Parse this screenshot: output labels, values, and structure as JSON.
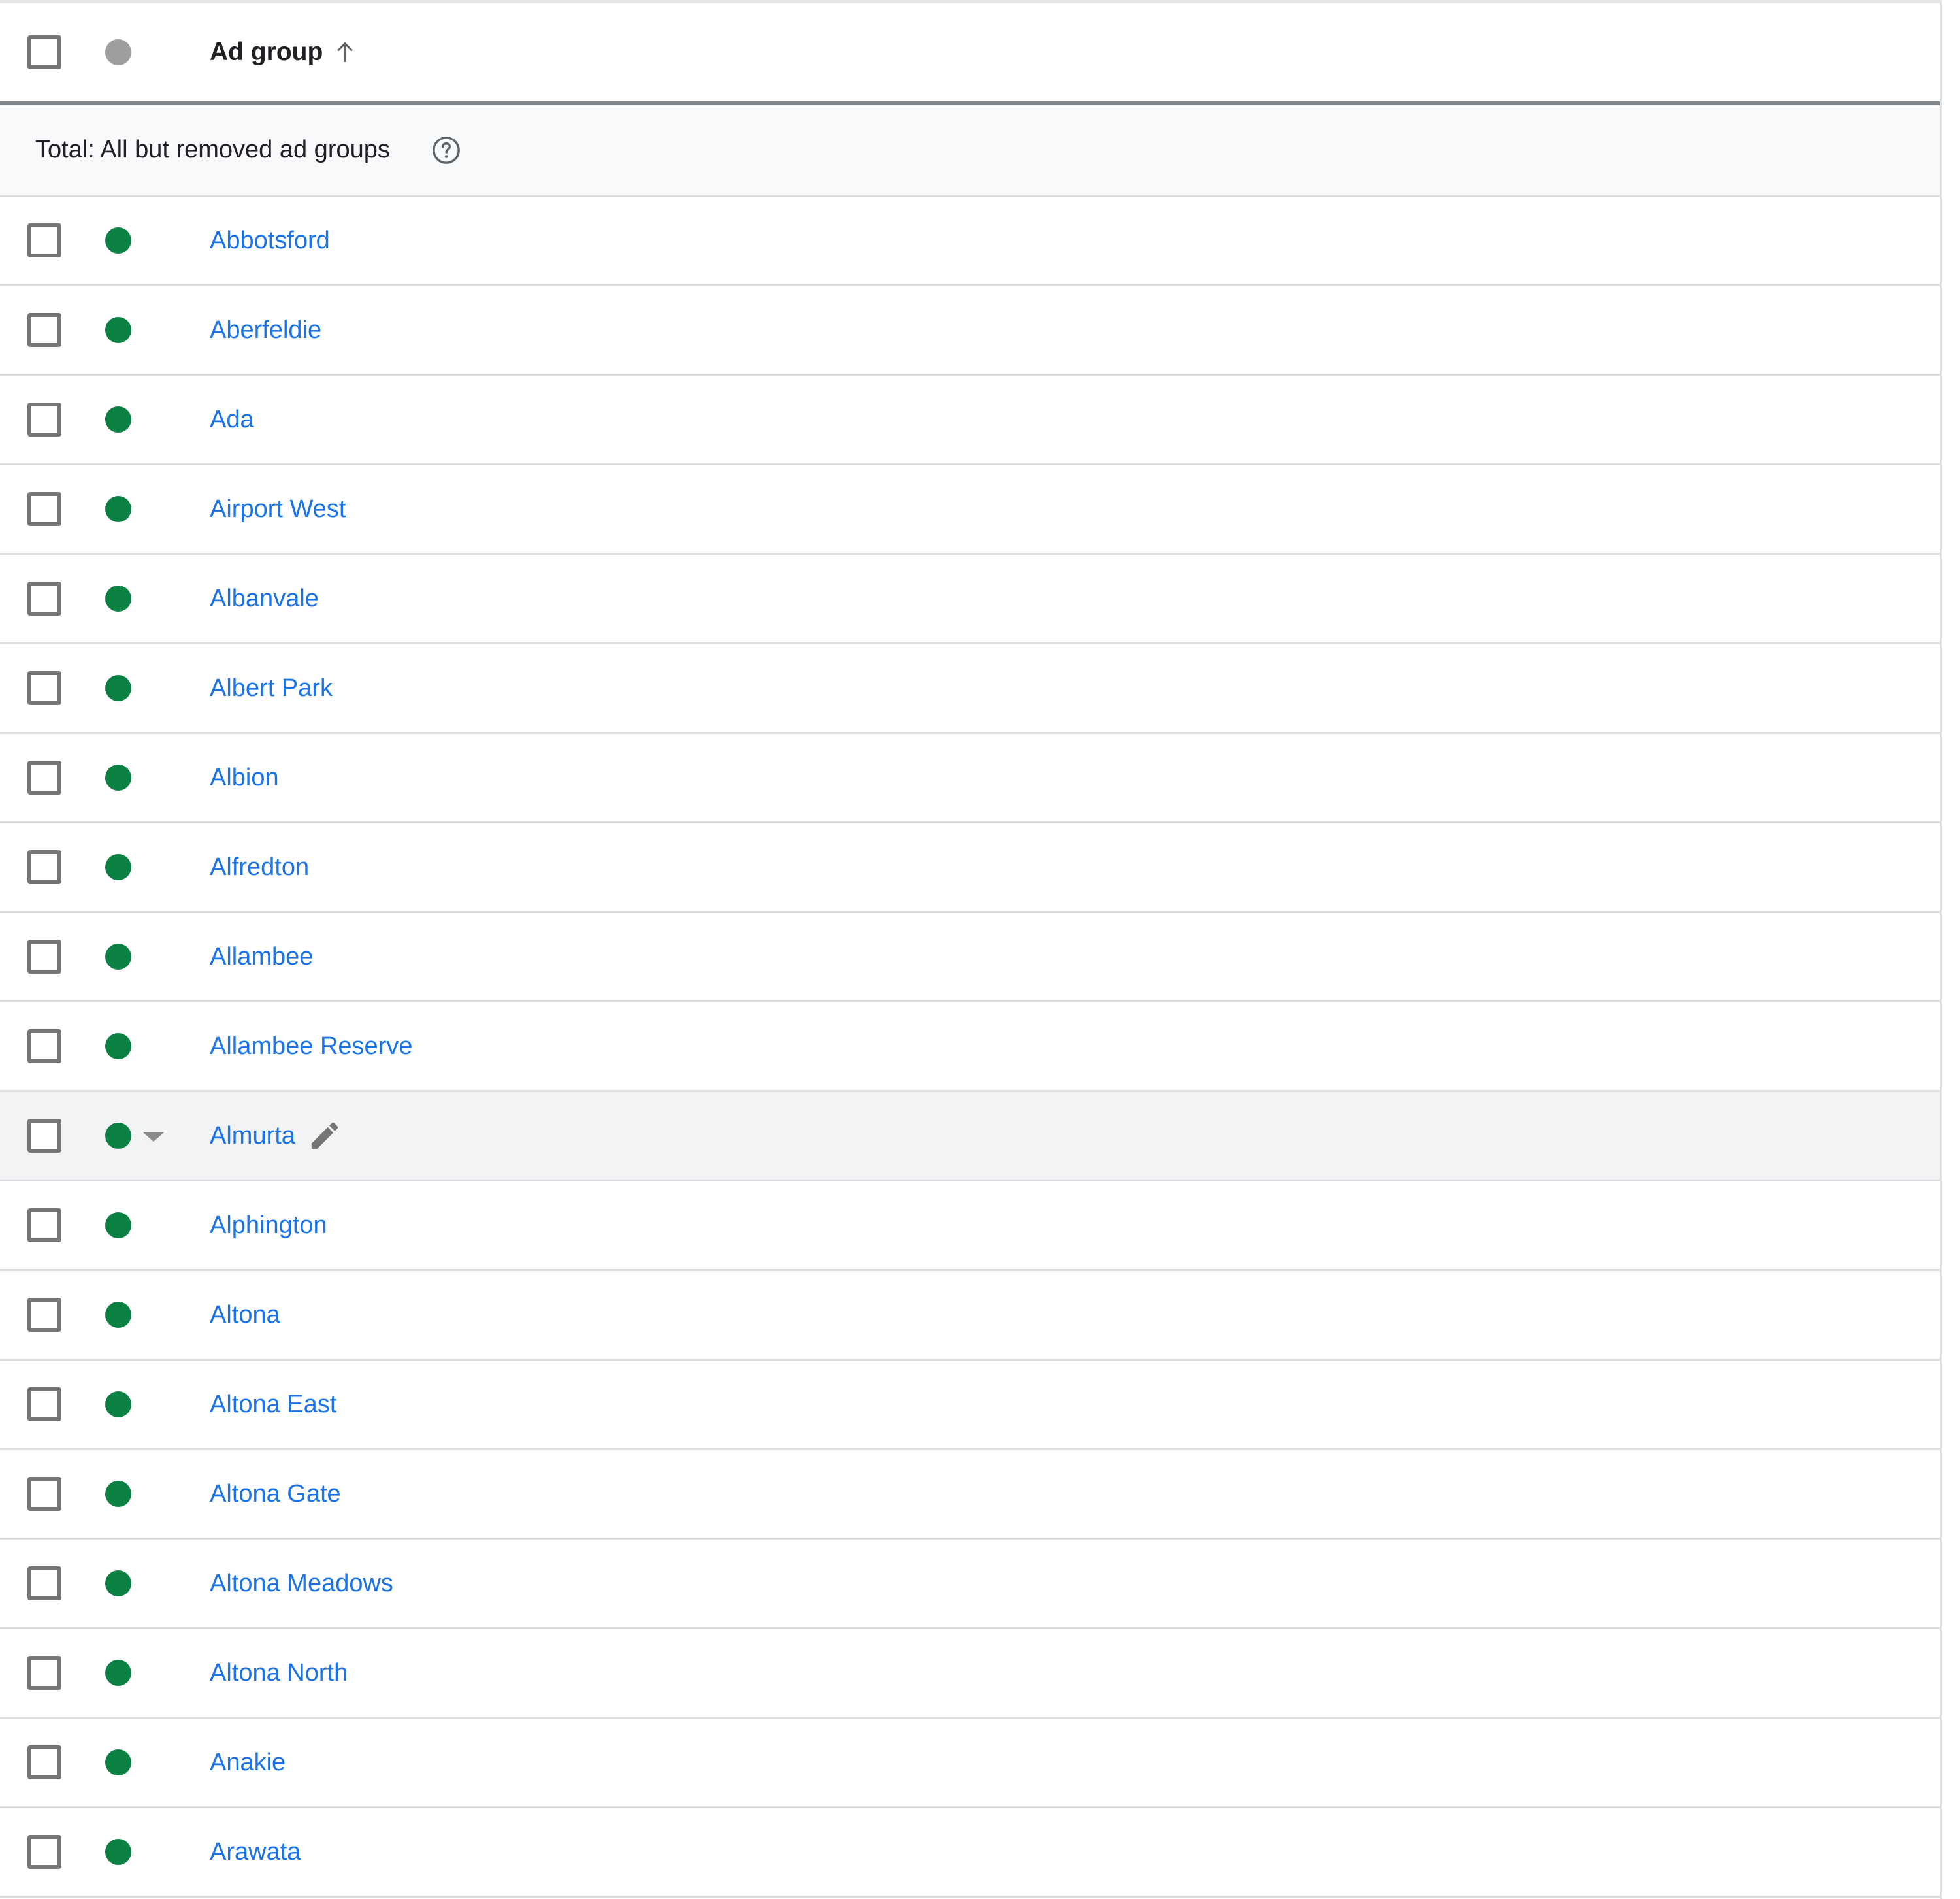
{
  "table": {
    "header": {
      "column_label": "Ad group",
      "sort_direction": "ascending",
      "sort_icon": "arrow-up-icon",
      "status_icon": "status-dot-icon"
    },
    "total_row": {
      "label": "Total: All but removed ad groups",
      "help_icon": "help-circle-icon"
    },
    "status_colors": {
      "enabled": "#0b8043",
      "header": "#9e9e9e"
    },
    "link_color": "#1a73e8",
    "rows": [
      {
        "name": "Abbotsford",
        "status": "enabled",
        "checked": false
      },
      {
        "name": "Aberfeldie",
        "status": "enabled",
        "checked": false
      },
      {
        "name": "Ada",
        "status": "enabled",
        "checked": false
      },
      {
        "name": "Airport West",
        "status": "enabled",
        "checked": false
      },
      {
        "name": "Albanvale",
        "status": "enabled",
        "checked": false
      },
      {
        "name": "Albert Park",
        "status": "enabled",
        "checked": false
      },
      {
        "name": "Albion",
        "status": "enabled",
        "checked": false
      },
      {
        "name": "Alfredton",
        "status": "enabled",
        "checked": false
      },
      {
        "name": "Allambee",
        "status": "enabled",
        "checked": false
      },
      {
        "name": "Allambee Reserve",
        "status": "enabled",
        "checked": false
      },
      {
        "name": "Almurta",
        "status": "enabled",
        "checked": false,
        "hovered": true,
        "show_edit_icon": true,
        "show_status_dropdown": true
      },
      {
        "name": "Alphington",
        "status": "enabled",
        "checked": false
      },
      {
        "name": "Altona",
        "status": "enabled",
        "checked": false
      },
      {
        "name": "Altona East",
        "status": "enabled",
        "checked": false
      },
      {
        "name": "Altona Gate",
        "status": "enabled",
        "checked": false
      },
      {
        "name": "Altona Meadows",
        "status": "enabled",
        "checked": false
      },
      {
        "name": "Altona North",
        "status": "enabled",
        "checked": false
      },
      {
        "name": "Anakie",
        "status": "enabled",
        "checked": false
      },
      {
        "name": "Arawata",
        "status": "enabled",
        "checked": false
      }
    ]
  }
}
